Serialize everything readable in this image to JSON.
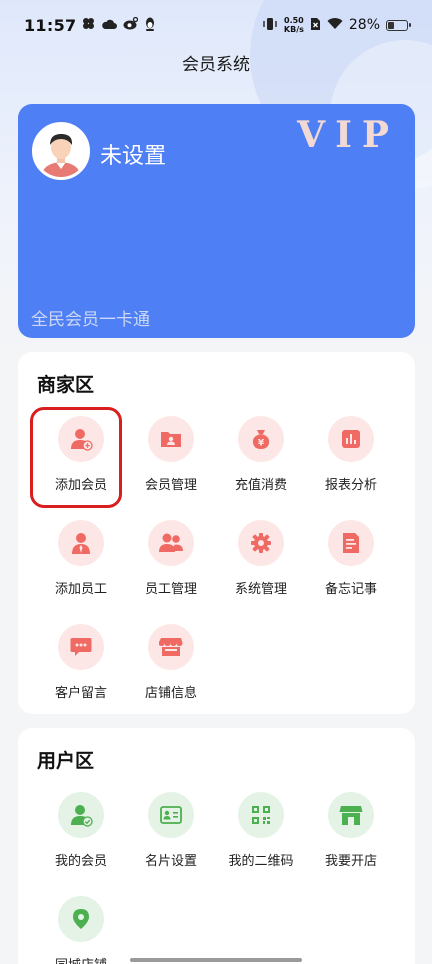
{
  "status_bar": {
    "time": "11:57",
    "net_speed_value": "0.50",
    "net_speed_unit": "KB/s",
    "battery": "28%",
    "battery_level": 0.28
  },
  "header": {
    "title": "会员系统"
  },
  "vip_card": {
    "member_name": "未设置",
    "badge": "VIP",
    "tagline": "全民会员一卡通",
    "color": "#4f7ff5"
  },
  "merchant_section": {
    "title": "商家区",
    "accent": "#f06a64",
    "items": [
      {
        "label": "添加会员",
        "icon": "add-member-icon"
      },
      {
        "label": "会员管理",
        "icon": "member-management-icon"
      },
      {
        "label": "充值消费",
        "icon": "recharge-icon"
      },
      {
        "label": "报表分析",
        "icon": "report-icon"
      },
      {
        "label": "添加员工",
        "icon": "add-staff-icon"
      },
      {
        "label": "员工管理",
        "icon": "staff-management-icon"
      },
      {
        "label": "系统管理",
        "icon": "gear-icon"
      },
      {
        "label": "备忘记事",
        "icon": "memo-icon"
      },
      {
        "label": "客户留言",
        "icon": "message-icon"
      },
      {
        "label": "店铺信息",
        "icon": "shop-info-icon"
      }
    ]
  },
  "user_section": {
    "title": "用户区",
    "accent": "#4caf50",
    "items": [
      {
        "label": "我的会员",
        "icon": "my-member-icon"
      },
      {
        "label": "名片设置",
        "icon": "business-card-icon"
      },
      {
        "label": "我的二维码",
        "icon": "qr-code-icon"
      },
      {
        "label": "我要开店",
        "icon": "open-shop-icon"
      },
      {
        "label": "同城店铺",
        "icon": "location-pin-icon"
      }
    ]
  }
}
